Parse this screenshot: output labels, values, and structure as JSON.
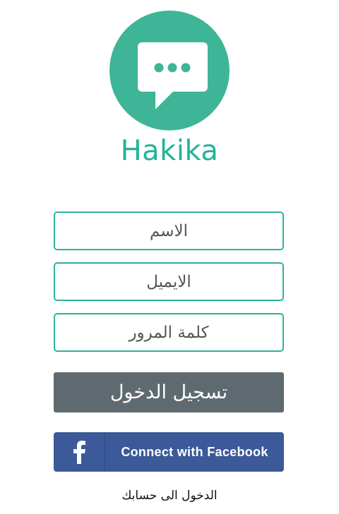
{
  "app": {
    "name": "Hakika",
    "brand_color": "#3eb596"
  },
  "logo": {
    "icon": "chat-bubble-dots-icon"
  },
  "form": {
    "name_placeholder": "الاسم",
    "email_placeholder": "الايميل",
    "password_placeholder": "كلمة المرور"
  },
  "buttons": {
    "register_label": "تسجيل الدخول",
    "register_color": "#5f6a70",
    "facebook_label": "Connect with Facebook",
    "facebook_icon": "facebook-f-icon",
    "facebook_color": "#3c5a99"
  },
  "footer": {
    "login_link": "الدخول الى حسابك"
  }
}
